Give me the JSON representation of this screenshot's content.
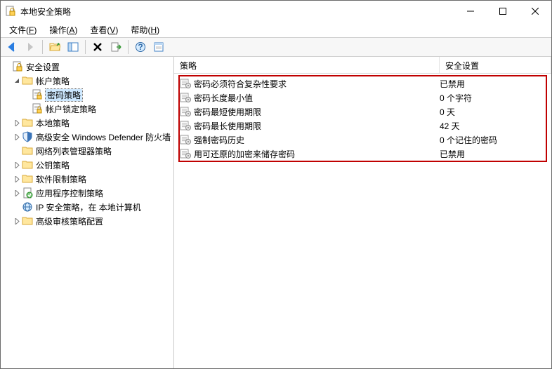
{
  "window": {
    "title": "本地安全策略"
  },
  "menu": {
    "file": {
      "label": "文件",
      "accel": "F"
    },
    "action": {
      "label": "操作",
      "accel": "A"
    },
    "view": {
      "label": "查看",
      "accel": "V"
    },
    "help": {
      "label": "帮助",
      "accel": "H"
    }
  },
  "tree": {
    "root": "安全设置",
    "account_policy": "帐户策略",
    "password_policy": "密码策略",
    "lockout_policy": "帐户锁定策略",
    "local_policy": "本地策略",
    "defender": "高级安全 Windows Defender 防火墙",
    "network_list": "网络列表管理器策略",
    "public_key": "公钥策略",
    "software_restriction": "软件限制策略",
    "app_control": "应用程序控制策略",
    "ip_security": "IP 安全策略，在 本地计算机",
    "audit": "高级审核策略配置"
  },
  "columns": {
    "policy": "策略",
    "setting": "安全设置"
  },
  "policies": [
    {
      "name": "密码必须符合复杂性要求",
      "value": "已禁用"
    },
    {
      "name": "密码长度最小值",
      "value": "0 个字符"
    },
    {
      "name": "密码最短使用期限",
      "value": "0 天"
    },
    {
      "name": "密码最长使用期限",
      "value": "42 天"
    },
    {
      "name": "强制密码历史",
      "value": "0 个记住的密码"
    },
    {
      "name": "用可还原的加密来储存密码",
      "value": "已禁用"
    }
  ]
}
